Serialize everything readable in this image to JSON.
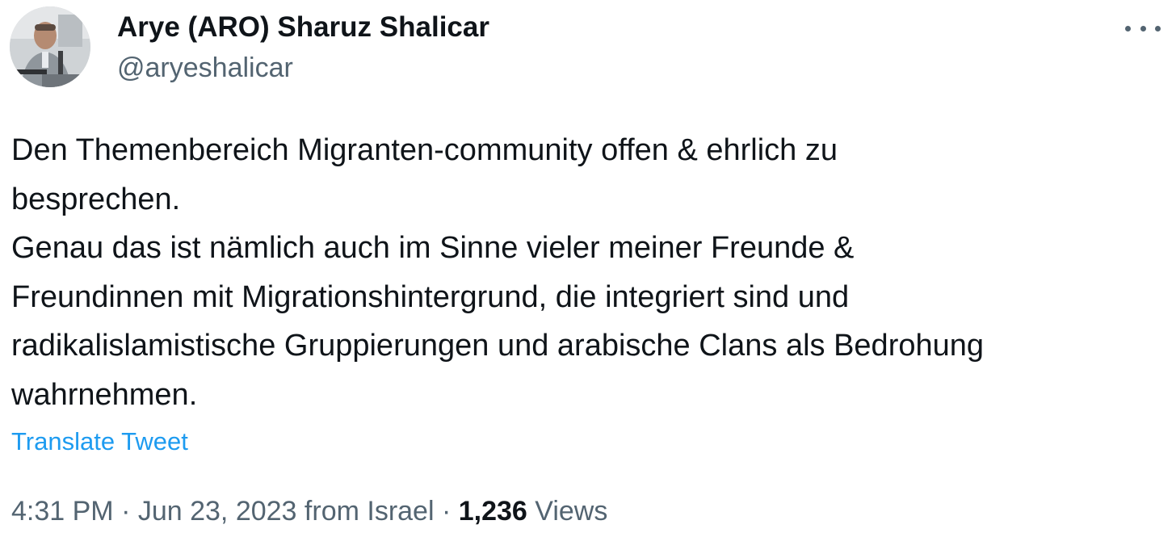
{
  "author": {
    "display_name": "Arye (ARO) Sharuz Shalicar",
    "handle": "@aryeshalicar",
    "avatar_icon": "profile-photo-avatar"
  },
  "more_icon": "more-horizontal-icon",
  "tweet": {
    "lines": [
      "Den Themenbereich Migranten-community offen & ehrlich zu",
      "besprechen.",
      "Genau das ist nämlich auch im Sinne vieler meiner Freunde &",
      "Freundinnen mit Migrationshintergrund, die integriert sind und",
      "radikalislamistische Gruppierungen und arabische Clans als Bedrohung",
      "wahrnehmen."
    ]
  },
  "translate_label": "Translate Tweet",
  "meta": {
    "time": "4:31 PM",
    "separator": " · ",
    "date": "Jun 23, 2023",
    "location": "from Israel",
    "views_count": "1,236",
    "views_label": "Views"
  },
  "colors": {
    "text": "#0f1419",
    "secondary": "#536471",
    "link": "#1d9bf0"
  }
}
